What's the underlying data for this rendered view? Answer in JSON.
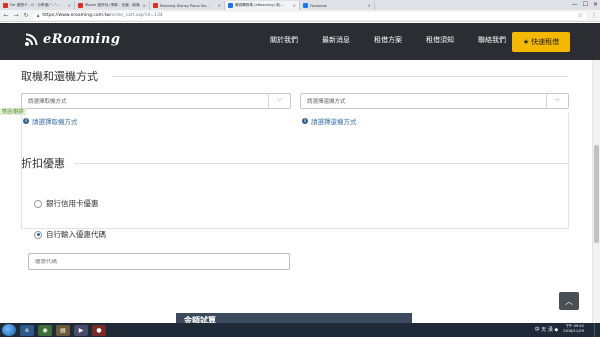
{
  "browser": {
    "tabs": [
      {
        "label": "For 禮物卡 - G · 分享禮(^-^...",
        "color": "#d93025",
        "active": false
      },
      {
        "label": "iRoam 遊好玩 (季節 - 全國 - 機場...",
        "color": "#d93025",
        "active": false
      },
      {
        "label": "Relaxing Disney Piano Mu...",
        "color": "#d93025",
        "active": false
      },
      {
        "label": "確認購物車 (eRoaming) 租...",
        "color": "#1a73e8",
        "active": true
      },
      {
        "label": "Facebook",
        "color": "#1877f2",
        "active": false
      }
    ],
    "url_host": "https://www.eroaming.com.tw",
    "url_path": "/order_cart.asp?id=134",
    "window_controls": [
      "—",
      "☐",
      "✕"
    ]
  },
  "header": {
    "logo_text": "eRoaming",
    "nav": [
      "關於我們",
      "最新消息",
      "租借方案",
      "租借須知",
      "聯絡我們"
    ],
    "quick_button": "快速租借"
  },
  "pickup_section": {
    "title": "取機和還機方式",
    "pickup_placeholder": "請選擇取機方式",
    "return_placeholder": "請選擇還機方式",
    "pickup_hint": "請選擇取機方式",
    "return_hint": "請選擇還機方式",
    "floating_label": "雙語/翻譯"
  },
  "discount_section": {
    "title": "折扣優惠",
    "options": [
      {
        "label": "銀行信用卡優惠",
        "checked": false
      },
      {
        "label": "自行輸入優惠代碼",
        "checked": true
      }
    ],
    "coupon_placeholder": "優惠代碼"
  },
  "summary": {
    "title": "金額試算"
  },
  "taskbar": {
    "ime": "中 天 漢 ◆",
    "time": "下午 09:42",
    "date": "2018/11/29"
  },
  "colors": {
    "header_bg": "#2b2d33",
    "accent": "#f5b800",
    "link": "#3a6fa8"
  }
}
